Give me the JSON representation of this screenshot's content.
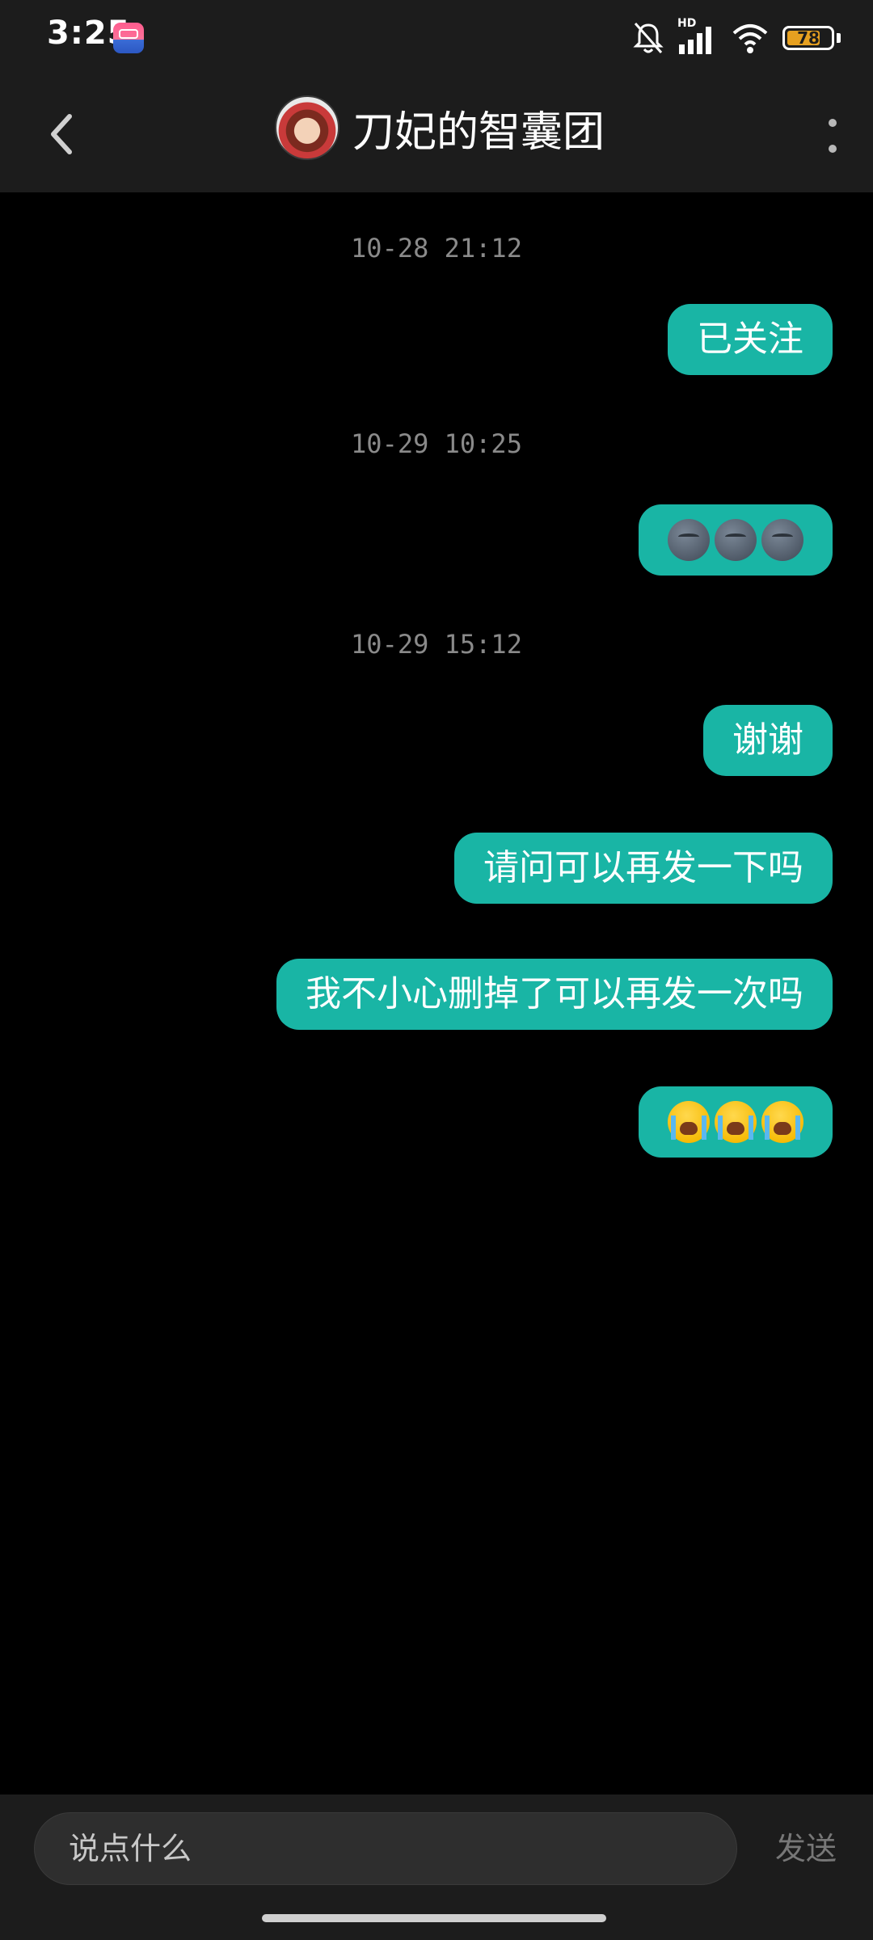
{
  "status_bar": {
    "time": "3:25",
    "network": "HD",
    "battery": "78"
  },
  "header": {
    "title": "刀妃的智囊团"
  },
  "messages": [
    {
      "type": "timestamp",
      "text": "10-28 21:12"
    },
    {
      "type": "text",
      "text": "已关注"
    },
    {
      "type": "timestamp",
      "text": "10-29 10:25"
    },
    {
      "type": "emoji",
      "emoji": "new-moon-face",
      "count": 3
    },
    {
      "type": "timestamp",
      "text": "10-29 15:12"
    },
    {
      "type": "text",
      "text": "谢谢"
    },
    {
      "type": "text",
      "text": "请问可以再发一下吗"
    },
    {
      "type": "text",
      "text": "我不小心删掉了可以再发一次吗"
    },
    {
      "type": "emoji",
      "emoji": "loudly-crying-face",
      "count": 3
    }
  ],
  "input": {
    "placeholder": "说点什么",
    "send_label": "发送"
  },
  "colors": {
    "bubble": "#19b5a5",
    "bar": "#1c1c1c",
    "background": "#000000"
  }
}
